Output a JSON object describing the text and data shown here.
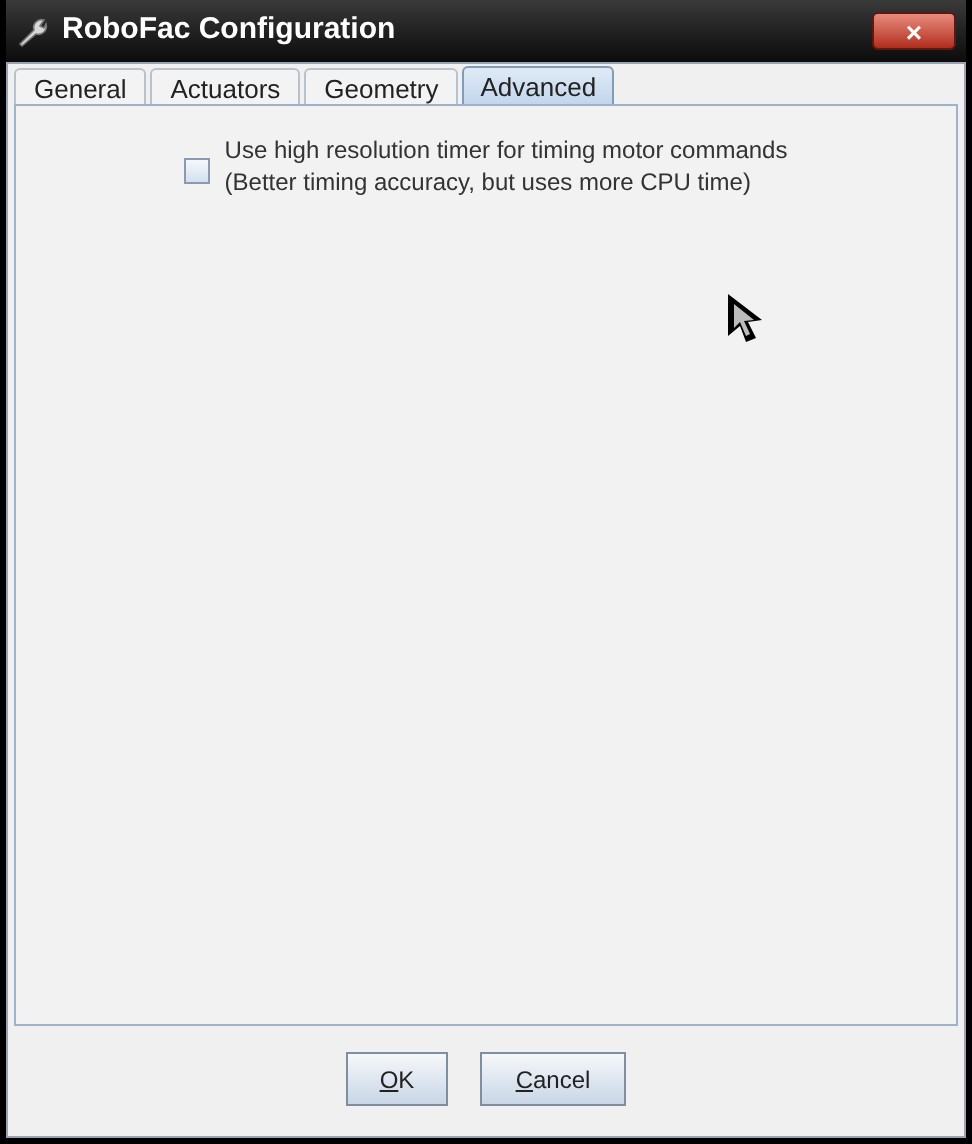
{
  "window": {
    "title": "RoboFac Configuration",
    "close": "×"
  },
  "tabs": [
    {
      "label": "General",
      "selected": false
    },
    {
      "label": "Actuators",
      "selected": false
    },
    {
      "label": "Geometry",
      "selected": false
    },
    {
      "label": "Advanced",
      "selected": true
    }
  ],
  "options": [
    {
      "label": "Use high resolution timer for timing motor commands",
      "note": "(Better timing accuracy, but uses more CPU time)",
      "checked": false
    }
  ],
  "buttons": [
    {
      "label": "OK",
      "first_letter_underlined": true
    },
    {
      "label": "Cancel",
      "first_letter_underlined": true
    }
  ]
}
